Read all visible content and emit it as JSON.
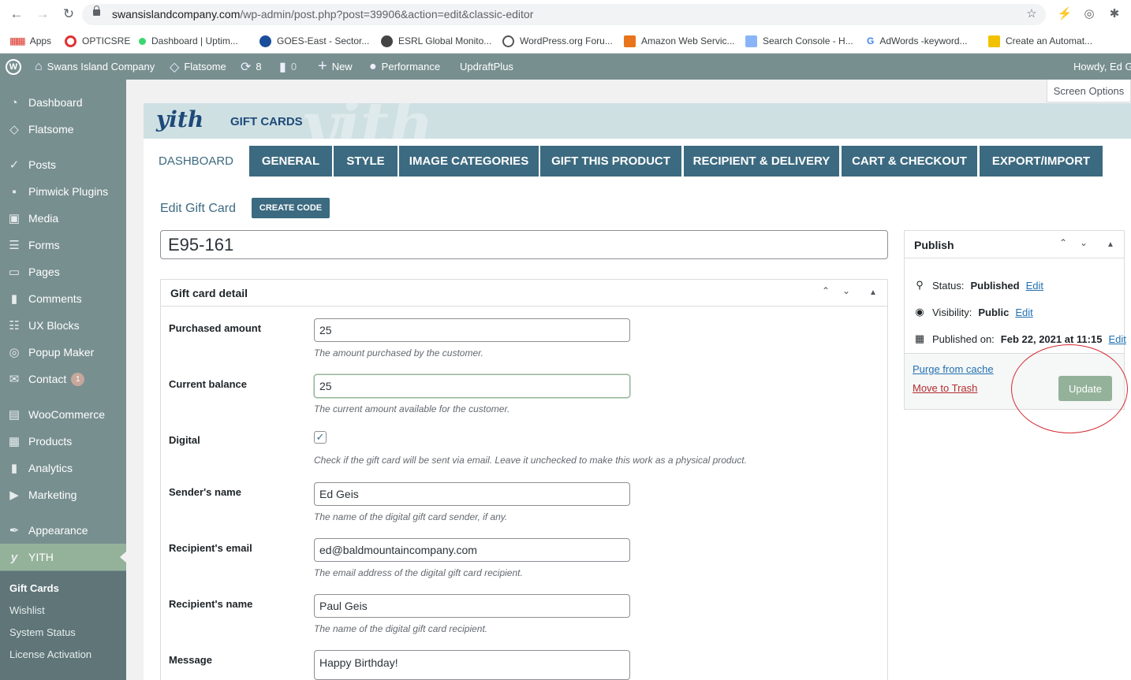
{
  "browser": {
    "url_host": "swansislandcompany.com",
    "url_path": "/wp-admin/post.php?post=39906&action=edit&classic-editor",
    "bookmarks": [
      "Apps",
      "OPTICSRE",
      "Dashboard | Uptim...",
      "GOES-East - Sector...",
      "ESRL Global Monito...",
      "WordPress.org Foru...",
      "Amazon Web Servic...",
      "Search Console - H...",
      "AdWords -keyword...",
      "Create an Automat..."
    ]
  },
  "adminbar": {
    "site": "Swans Island Company",
    "theme": "Flatsome",
    "updates": "8",
    "comments": "0",
    "new": "New",
    "performance": "Performance",
    "updraft": "UpdraftPlus",
    "howdy": "Howdy, Ed G"
  },
  "sidebar": {
    "items": [
      "Dashboard",
      "Flatsome",
      "Posts",
      "Pimwick Plugins",
      "Media",
      "Forms",
      "Pages",
      "Comments",
      "UX Blocks",
      "Popup Maker",
      "Contact",
      "WooCommerce",
      "Products",
      "Analytics",
      "Marketing",
      "Appearance",
      "YITH"
    ],
    "contact_badge": "1",
    "submenu": [
      "Gift Cards",
      "Wishlist",
      "System Status",
      "License Activation"
    ]
  },
  "screen_options": "Screen Options",
  "yith": {
    "logo": "yith",
    "title": "GIFT CARDS"
  },
  "tabs": [
    "DASHBOARD",
    "GENERAL",
    "STYLE",
    "IMAGE CATEGORIES",
    "GIFT THIS PRODUCT",
    "RECIPIENT & DELIVERY",
    "CART & CHECKOUT",
    "EXPORT/IMPORT"
  ],
  "editor": {
    "heading": "Edit Gift Card",
    "create_code": "CREATE CODE",
    "title_value": "E95-161"
  },
  "detail": {
    "title": "Gift card detail",
    "purchased_label": "Purchased amount",
    "purchased_value": "25",
    "purchased_desc": "The amount purchased by the customer.",
    "balance_label": "Current balance",
    "balance_value": "25",
    "balance_desc": "The current amount available for the customer.",
    "digital_label": "Digital",
    "digital_checked": true,
    "digital_desc": "Check if the gift card will be sent via email. Leave it unchecked to make this work as a physical product.",
    "sender_label": "Sender's name",
    "sender_value": "Ed Geis",
    "sender_desc": "The name of the digital gift card sender, if any.",
    "remail_label": "Recipient's email",
    "remail_value": "ed@baldmountaincompany.com",
    "remail_desc": "The email address of the digital gift card recipient.",
    "rname_label": "Recipient's name",
    "rname_value": "Paul Geis",
    "rname_desc": "The name of the digital gift card recipient.",
    "message_label": "Message",
    "message_value": "Happy Birthday!"
  },
  "publish": {
    "title": "Publish",
    "status_label": "Status:",
    "status_value": "Published",
    "visibility_label": "Visibility:",
    "visibility_value": "Public",
    "published_label": "Published on:",
    "published_value": "Feb 22, 2021 at 11:15",
    "edit": "Edit",
    "purge": "Purge from cache",
    "trash": "Move to Trash",
    "update": "Update"
  },
  "colors": {
    "admin": "#788f90",
    "accent": "#3c6a80",
    "update": "#94b29a",
    "annotation": "#d42a33"
  }
}
